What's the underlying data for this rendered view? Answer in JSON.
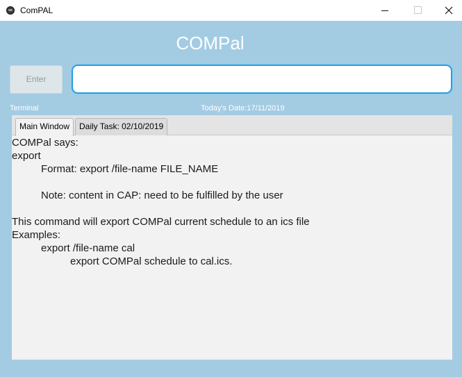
{
  "window": {
    "title": "ComPAL",
    "icon": "app-icon"
  },
  "header": {
    "title": "COMPal"
  },
  "input": {
    "enter_label": "Enter",
    "value": "",
    "placeholder": ""
  },
  "status": {
    "terminal_label": "Terminal",
    "today_date": "Today's Date:17/11/2019"
  },
  "tabs": [
    {
      "label": "Main Window",
      "selected": true
    },
    {
      "label": "Daily Task: 02/10/2019",
      "selected": false
    }
  ],
  "output": {
    "lines": [
      "COMPal says:",
      "export",
      "Format: export /file-name FILE_NAME",
      "",
      "Note: content in CAP: need to be fulfilled by the user",
      "",
      "This command will export COMPal current schedule to an ics file",
      "Examples:",
      "export /file-name cal",
      "export COMPal schedule to cal.ics."
    ]
  },
  "colors": {
    "background": "#a3cce3",
    "input_focus": "#2a9de0",
    "pane": "#f2f2f2"
  }
}
